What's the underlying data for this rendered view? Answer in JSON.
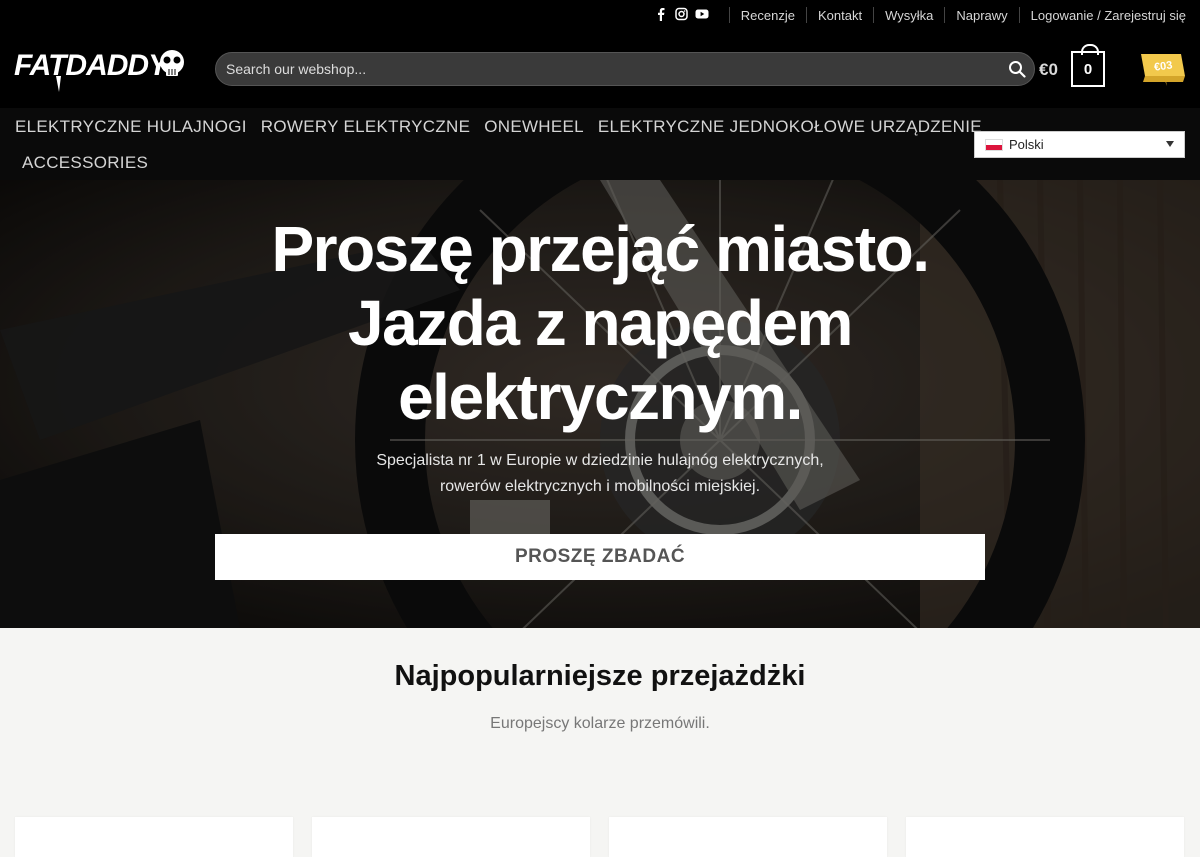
{
  "topbar": {
    "social_icons": [
      "facebook-icon",
      "instagram-icon",
      "youtube-icon"
    ],
    "links": [
      "Recenzje",
      "Kontakt",
      "Wysyłka",
      "Naprawy",
      "Logowanie / Zarejestruj się"
    ]
  },
  "header": {
    "logo_text": "FATDADDY",
    "search_placeholder": "Search our webshop...",
    "cart_total": "€0",
    "cart_count": "0",
    "badge_text": "€03"
  },
  "nav": {
    "items": [
      "ELEKTRYCZNE HULAJNOGI",
      "ROWERY ELEKTRYCZNE",
      "ONEWHEEL",
      "ELEKTRYCZNE JEDNOKOŁOWE URZĄDZENIE"
    ],
    "item_row2": "ACCESSORIES",
    "language": "Polski"
  },
  "hero": {
    "headline_line1": "Proszę przejąć miasto.",
    "headline_line2": "Jazda z napędem",
    "headline_line3": "elektrycznym.",
    "subtitle_line1": "Specjalista nr 1 w Europie w dziedzinie hulajnóg elektrycznych,",
    "subtitle_line2": "rowerów elektrycznych i mobilności miejskiej.",
    "cta_label": "PROSZĘ ZBADAĆ"
  },
  "popular": {
    "title": "Najpopularniejsze przejażdżki",
    "subtitle": "Europejscy kolarze przemówili."
  },
  "colors": {
    "header_bg": "#000000",
    "nav_bg": "#0a0a0a",
    "section_bg": "#f5f5f3",
    "flag_red": "#dc143c"
  }
}
